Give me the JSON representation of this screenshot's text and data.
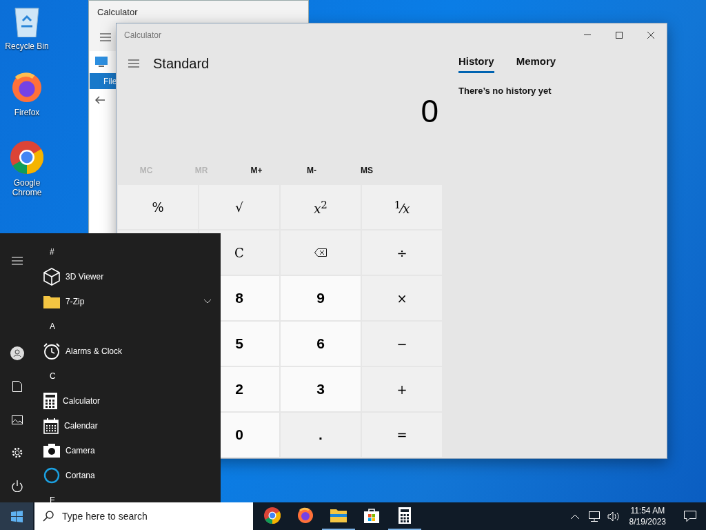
{
  "desktop_icons": [
    {
      "label": "Recycle Bin"
    },
    {
      "label": "Firefox"
    },
    {
      "label": "Google Chrome"
    }
  ],
  "back_window": {
    "title": "Calculator",
    "ribbon_tab": "File"
  },
  "calculator": {
    "title": "Calculator",
    "mode": "Standard",
    "display": "0",
    "memory_buttons": [
      {
        "label": "MC",
        "disabled": true
      },
      {
        "label": "MR",
        "disabled": true
      },
      {
        "label": "M+",
        "disabled": false
      },
      {
        "label": "M-",
        "disabled": false
      },
      {
        "label": "MS",
        "disabled": false
      }
    ],
    "keys": [
      {
        "kind": "function",
        "label": "%"
      },
      {
        "kind": "function",
        "label": "√"
      },
      {
        "kind": "function",
        "label": "*x*$^{2}$"
      },
      {
        "kind": "function",
        "label": "$^{1}$⁄*x*"
      },
      {
        "kind": "function"
      },
      {
        "kind": "function",
        "label": "C"
      },
      {
        "kind": "backspace"
      },
      {
        "kind": "function",
        "label": "÷"
      },
      {
        "kind": "digit"
      },
      {
        "kind": "digit",
        "label": "8"
      },
      {
        "kind": "digit",
        "label": "9"
      },
      {
        "kind": "function",
        "label": "×"
      },
      {
        "kind": "digit"
      },
      {
        "kind": "digit",
        "label": "5"
      },
      {
        "kind": "digit",
        "label": "6"
      },
      {
        "kind": "function",
        "label": "−"
      },
      {
        "kind": "digit"
      },
      {
        "kind": "digit",
        "label": "2"
      },
      {
        "kind": "digit",
        "label": "3"
      },
      {
        "kind": "function",
        "label": "+"
      },
      {
        "kind": "digit"
      },
      {
        "kind": "digit",
        "label": "0"
      },
      {
        "kind": "decimal",
        "label": "."
      },
      {
        "kind": "function",
        "label": "="
      }
    ],
    "panel_tabs": [
      {
        "label": "History",
        "selected": true
      },
      {
        "label": "Memory",
        "selected": false
      }
    ],
    "history_message": "There’s no history yet"
  },
  "start_menu": {
    "entries": [
      {
        "kind": "header",
        "label": "#"
      },
      {
        "kind": "app",
        "label": "3D Viewer"
      },
      {
        "kind": "folder",
        "label": "7-Zip",
        "expanded": false
      },
      {
        "kind": "header",
        "label": "A"
      },
      {
        "kind": "app",
        "label": "Alarms & Clock"
      },
      {
        "kind": "header",
        "label": "C"
      },
      {
        "kind": "app",
        "label": "Calculator"
      },
      {
        "kind": "app",
        "label": "Calendar"
      },
      {
        "kind": "app",
        "label": "Camera"
      },
      {
        "kind": "app",
        "label": "Cortana"
      },
      {
        "kind": "header",
        "label": "E"
      }
    ]
  },
  "taskbar": {
    "search": {
      "placeholder": "Type here to search"
    },
    "pinned": [
      {
        "active": false
      },
      {
        "active": false
      },
      {
        "active": true
      },
      {
        "active": false
      },
      {
        "active": true
      }
    ],
    "time": "11:54 AM",
    "date": "8/19/2023"
  }
}
